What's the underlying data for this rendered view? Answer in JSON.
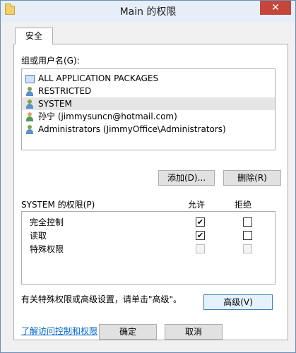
{
  "window": {
    "title": "Main 的权限",
    "close_label": "✕"
  },
  "tabs": [
    {
      "label": "安全"
    }
  ],
  "groups": {
    "label": "组或用户名(G):",
    "items": [
      {
        "label": "ALL APPLICATION PACKAGES",
        "icon": "app-package-icon"
      },
      {
        "label": "RESTRICTED",
        "icon": "group-icon"
      },
      {
        "label": "SYSTEM",
        "icon": "group-icon",
        "selected": true
      },
      {
        "label": "孙宁 (jimmysuncn@hotmail.com)",
        "icon": "user-icon"
      },
      {
        "label": "Administrators (JimmyOffice\\Administrators)",
        "icon": "group-icon"
      }
    ],
    "add_button": "添加(D)...",
    "remove_button": "删除(R)"
  },
  "permissions": {
    "label": "SYSTEM 的权限(P)",
    "allow_header": "允许",
    "deny_header": "拒绝",
    "rows": [
      {
        "name": "完全控制",
        "allow": "✔",
        "deny": ""
      },
      {
        "name": "读取",
        "allow": "✔",
        "deny": ""
      },
      {
        "name": "特殊权限",
        "allow": "",
        "deny": ""
      }
    ]
  },
  "advanced": {
    "text": "有关特殊权限或高级设置，请单击\"高级\"。",
    "button": "高级(V)"
  },
  "learn_link": "了解访问控制和权限",
  "footer": {
    "ok": "确定",
    "cancel": "取消"
  },
  "colors": {
    "selected_row": "#e5e5e5",
    "link": "#0066cc",
    "close_button": "#c7463b"
  }
}
